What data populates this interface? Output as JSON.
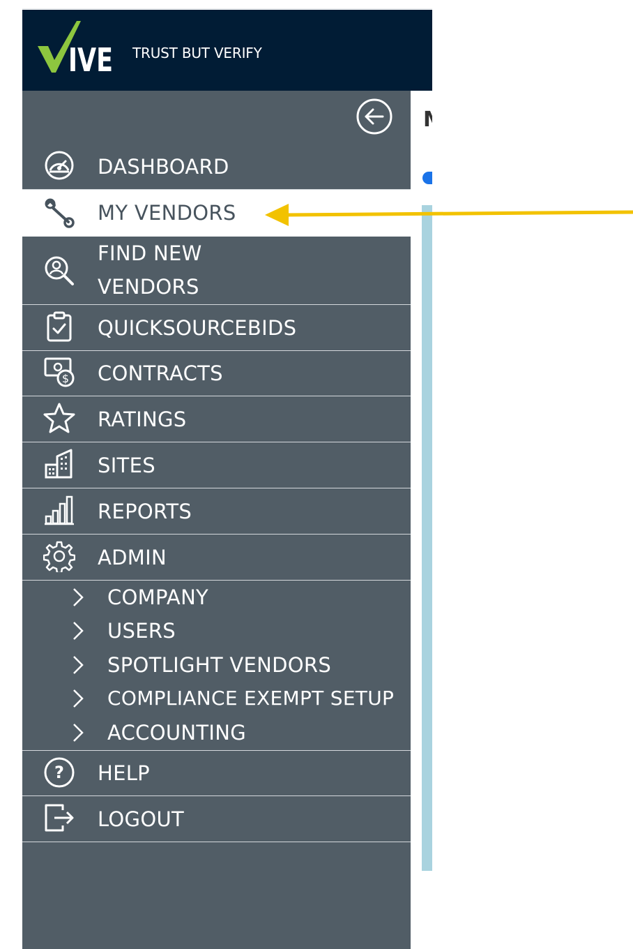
{
  "header": {
    "logo_text": "VIVE",
    "tagline": "TRUST BUT VERIFY"
  },
  "colors": {
    "header_bg": "#011c35",
    "sidebar_bg": "#515d66",
    "logo_check": "#8dc63f",
    "active_bg": "#ffffff",
    "active_text": "#47535d",
    "annotation_arrow": "#f2c200"
  },
  "sidebar": {
    "collapse_icon": "arrow-left-circle-icon",
    "items": [
      {
        "label": "DASHBOARD",
        "icon": "speedometer-icon"
      },
      {
        "label": "MY VENDORS",
        "icon": "wrench-icon",
        "active": true
      },
      {
        "label_line1": "FIND NEW",
        "label_line2": "VENDORS",
        "icon": "search-person-icon"
      },
      {
        "label": "QUICKSOURCEBIDS",
        "icon": "clipboard-check-icon"
      },
      {
        "label": "CONTRACTS",
        "icon": "money-dollar-icon"
      },
      {
        "label": "RATINGS",
        "icon": "star-icon"
      },
      {
        "label": "SITES",
        "icon": "buildings-icon"
      },
      {
        "label": "REPORTS",
        "icon": "bar-chart-icon"
      },
      {
        "label": "ADMIN",
        "icon": "gear-icon"
      }
    ],
    "admin_sub": [
      {
        "label": "COMPANY"
      },
      {
        "label": "USERS"
      },
      {
        "label": "SPOTLIGHT VENDORS"
      },
      {
        "label": "COMPLIANCE EXEMPT SETUP"
      },
      {
        "label": "ACCOUNTING"
      }
    ],
    "bottom": [
      {
        "label": "HELP",
        "icon": "question-circle-icon"
      },
      {
        "label": "LOGOUT",
        "icon": "logout-icon"
      }
    ]
  },
  "main": {
    "title_fragment": "M"
  }
}
